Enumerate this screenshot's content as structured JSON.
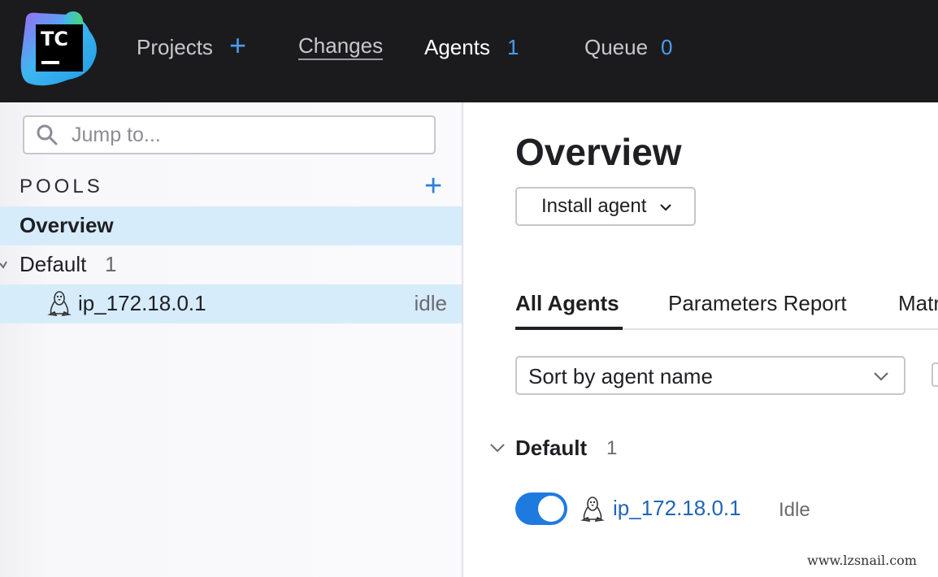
{
  "header": {
    "logo_text": "TC",
    "nav": {
      "projects": "Projects",
      "projects_add": "+",
      "changes": "Changes",
      "agents": "Agents",
      "agents_count": "1",
      "queue": "Queue",
      "queue_count": "0"
    }
  },
  "sidebar": {
    "search_placeholder": "Jump to...",
    "pools_title": "POOLS",
    "pools_add": "+",
    "items": [
      {
        "label": "Overview"
      },
      {
        "label": "Default",
        "count": "1"
      },
      {
        "label": "ip_172.18.0.1",
        "status": "idle",
        "icon": "linux-icon"
      }
    ]
  },
  "main": {
    "title": "Overview",
    "install_agent": "Install agent",
    "tabs": [
      {
        "label": "All Agents"
      },
      {
        "label": "Parameters Report"
      },
      {
        "label": "Matr"
      }
    ],
    "sort_value": "Sort by agent name",
    "group": {
      "name": "Default",
      "count": "1",
      "agent": {
        "name": "ip_172.18.0.1",
        "status": "Idle"
      }
    }
  },
  "watermark": "www.lzsnail.com",
  "colors": {
    "header_bg": "#1b1b1d",
    "accent": "#4a9cf0",
    "selected_row": "#d6ecfb",
    "toggle_on": "#1f7ae0",
    "link": "#1f64b8"
  }
}
